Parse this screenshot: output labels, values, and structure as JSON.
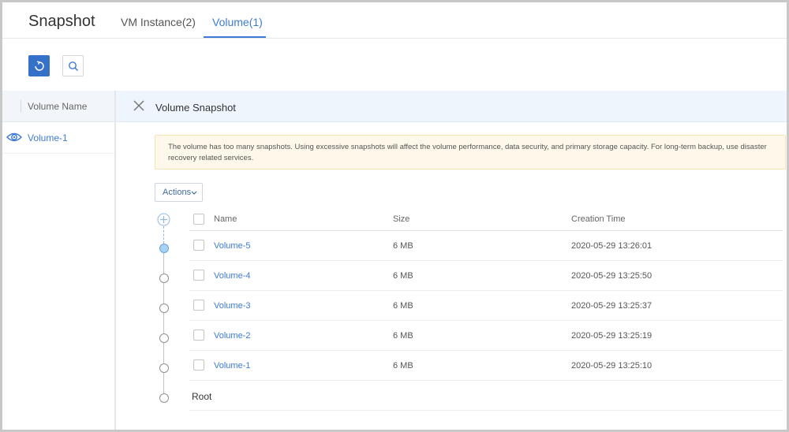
{
  "header": {
    "title": "Snapshot",
    "tabs": [
      {
        "label": "VM Instance(2)"
      },
      {
        "label": "Volume(1)"
      }
    ]
  },
  "toolbar": {
    "refresh_icon": "refresh-icon",
    "search_icon": "search-icon"
  },
  "left_panel": {
    "column_header": "Volume Name",
    "items": [
      {
        "label": "Volume-1",
        "icon": "eye-icon"
      }
    ]
  },
  "detail": {
    "title": "Volume Snapshot",
    "warning": "The volume has too many snapshots. Using excessive snapshots will affect the volume performance, data security, and primary storage capacity. For long-term backup, use disaster recovery related services.",
    "actions_label": "Actions",
    "columns": {
      "name": "Name",
      "size": "Size",
      "time": "Creation Time"
    },
    "rows": [
      {
        "name": "Volume-5",
        "size": "6 MB",
        "time": "2020-05-29 13:26:01"
      },
      {
        "name": "Volume-4",
        "size": "6 MB",
        "time": "2020-05-29 13:25:50"
      },
      {
        "name": "Volume-3",
        "size": "6 MB",
        "time": "2020-05-29 13:25:37"
      },
      {
        "name": "Volume-2",
        "size": "6 MB",
        "time": "2020-05-29 13:25:19"
      },
      {
        "name": "Volume-1",
        "size": "6 MB",
        "time": "2020-05-29 13:25:10"
      }
    ],
    "root_label": "Root"
  },
  "colors": {
    "accent": "#3d7bd6",
    "primary_button": "#3571c9",
    "warning_bg": "#fdf8ea",
    "panel_header_bg": "#eef5fd"
  }
}
